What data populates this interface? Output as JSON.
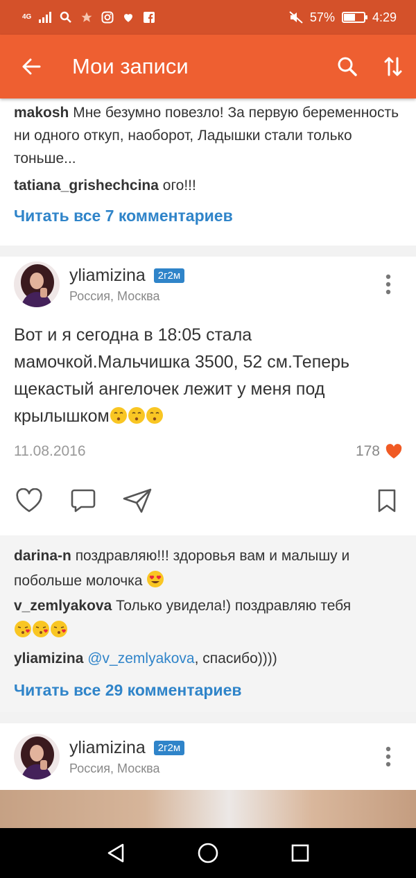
{
  "status_bar": {
    "network": "4G",
    "battery_percent": "57%",
    "battery_level": 0.57,
    "time": "4:29"
  },
  "app_bar": {
    "title": "Мои записи",
    "icons": [
      "back-arrow-icon",
      "search-icon",
      "sort-icon"
    ]
  },
  "prev_post": {
    "comments": [
      {
        "user": "makosh",
        "text": "Мне безумно повезло! За первую беременность ни одного откуп, наоборот, Ладышки стали только тоньше..."
      },
      {
        "user": "tatiana_grishechcina",
        "text": "ого!!!"
      }
    ],
    "read_all": "Читать все 7 комментариев"
  },
  "post": {
    "username": "yliamizina",
    "badge": "2г2м",
    "location": "Россия, Москва",
    "text": "Вот и я сегодна в 18:05 стала мамочкой.Мальчишка 3500, 52 см.Теперь щекастый ангелочек лежит у меня под крылышком",
    "date": "11.08.2016",
    "likes": "178",
    "comments": [
      {
        "user": "darina-n",
        "text": "поздравляю!!! здоровья вам и малышу и побольше молочка"
      },
      {
        "user": "v_zemlyakova",
        "text": "Только увидела!) поздравляю тебя"
      },
      {
        "user": "yliamizina",
        "mention": "@v_zemlyakova",
        "text": ", спасибо))))"
      }
    ],
    "read_all": "Читать все 29 комментариев"
  },
  "next_post": {
    "username": "yliamizina",
    "badge": "2г2м",
    "location": "Россия, Москва"
  },
  "colors": {
    "status_bar": "#d4512a",
    "app_bar": "#ee5f31",
    "link": "#2f84c9",
    "like_heart": "#f05a24"
  }
}
